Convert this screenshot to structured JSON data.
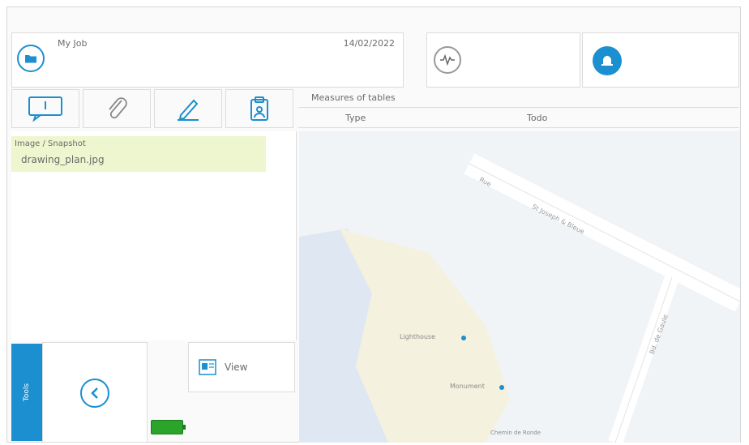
{
  "header": {
    "name": "My Job",
    "date": "14/02/2022"
  },
  "icons": {
    "folder": "folder-icon",
    "activity": "activity-icon",
    "bell": "bell-icon",
    "message": "message-icon",
    "paperclip": "paperclip-icon",
    "pencil": "pencil-icon",
    "clipboard": "clipboard-icon",
    "back": "chevron-left-icon",
    "view": "image-icon",
    "battery": "battery-icon"
  },
  "measures": {
    "title": "Measures of tables",
    "columns": [
      "Type",
      "Todo"
    ]
  },
  "attachment": {
    "label": "Image / Snapshot",
    "filename": "drawing_plan.jpg"
  },
  "actions": {
    "side_tab": "Tools",
    "view_label": "View"
  },
  "map": {
    "road_label_1": "Rue",
    "road_label_2": "St Joseph & Bleue",
    "road_label_3": "Bd. de Gaule",
    "poi_1": "Lighthouse",
    "poi_2": "Monument",
    "footer_label": "Chemin de Ronde"
  },
  "colors": {
    "accent": "#1b8fcf",
    "highlight": "#eef6cf",
    "battery": "#2aa52a",
    "water": "#dfe8f2",
    "land": "#f4f1de"
  }
}
